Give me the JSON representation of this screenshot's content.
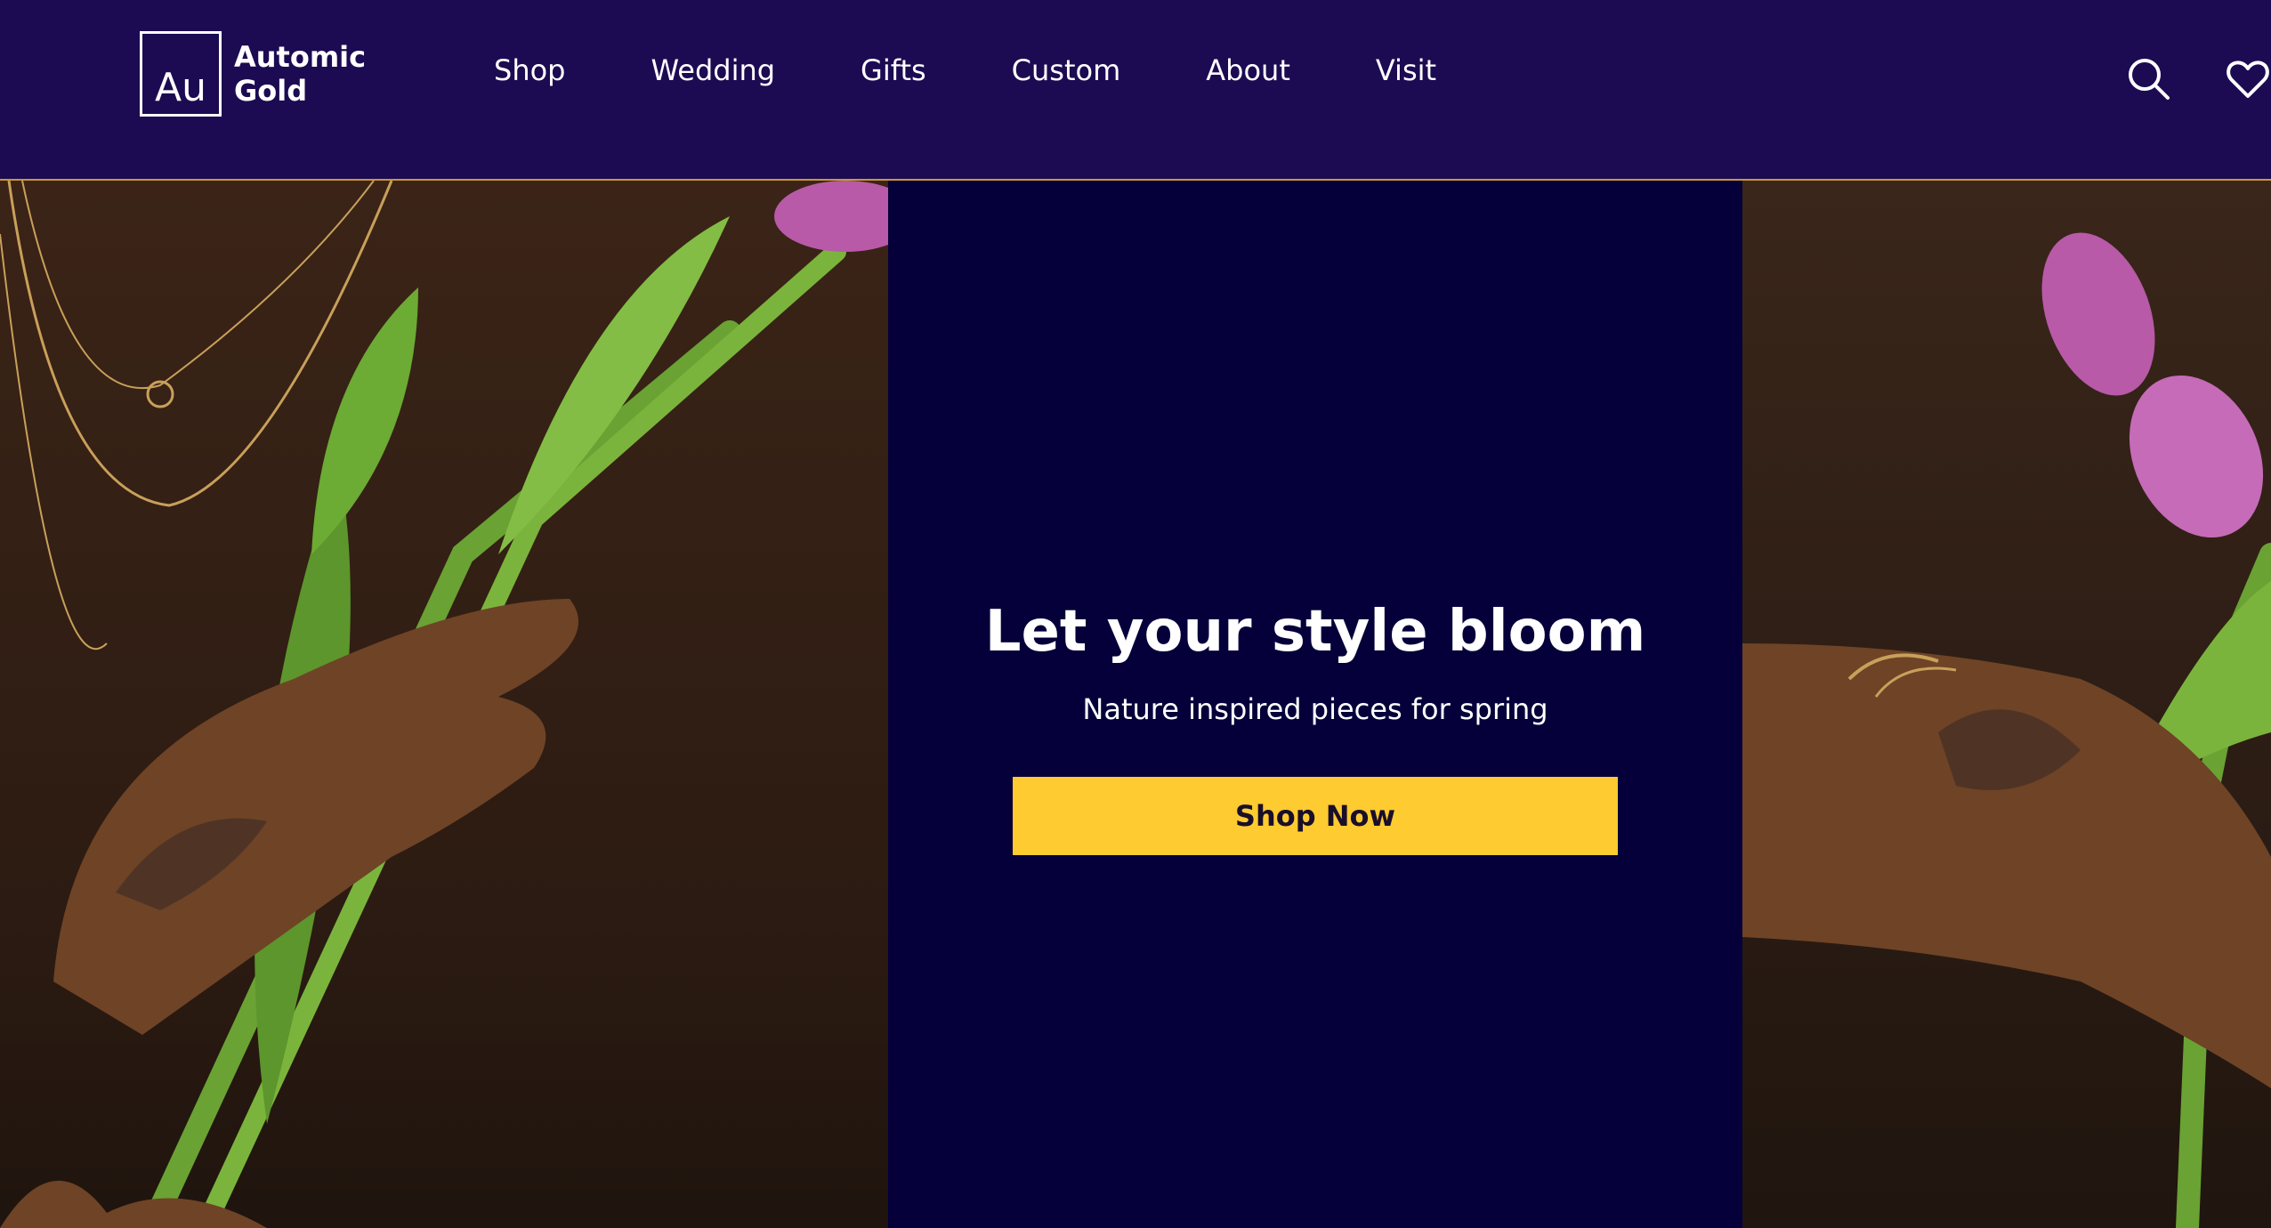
{
  "brand": {
    "mark": "Au",
    "line1": "Automic",
    "line2": "Gold"
  },
  "nav": [
    "Shop",
    "Wedding",
    "Gifts",
    "Custom",
    "About",
    "Visit"
  ],
  "icons": [
    "search-icon",
    "heart-icon"
  ],
  "hero": {
    "headline": "Let your style bloom",
    "subline": "Nature inspired pieces for spring",
    "cta": "Shop Now"
  },
  "colors": {
    "header": "#1c0b52",
    "hero_center": "#05003a",
    "cta": "#fecb30",
    "rule": "#c99a2e"
  }
}
